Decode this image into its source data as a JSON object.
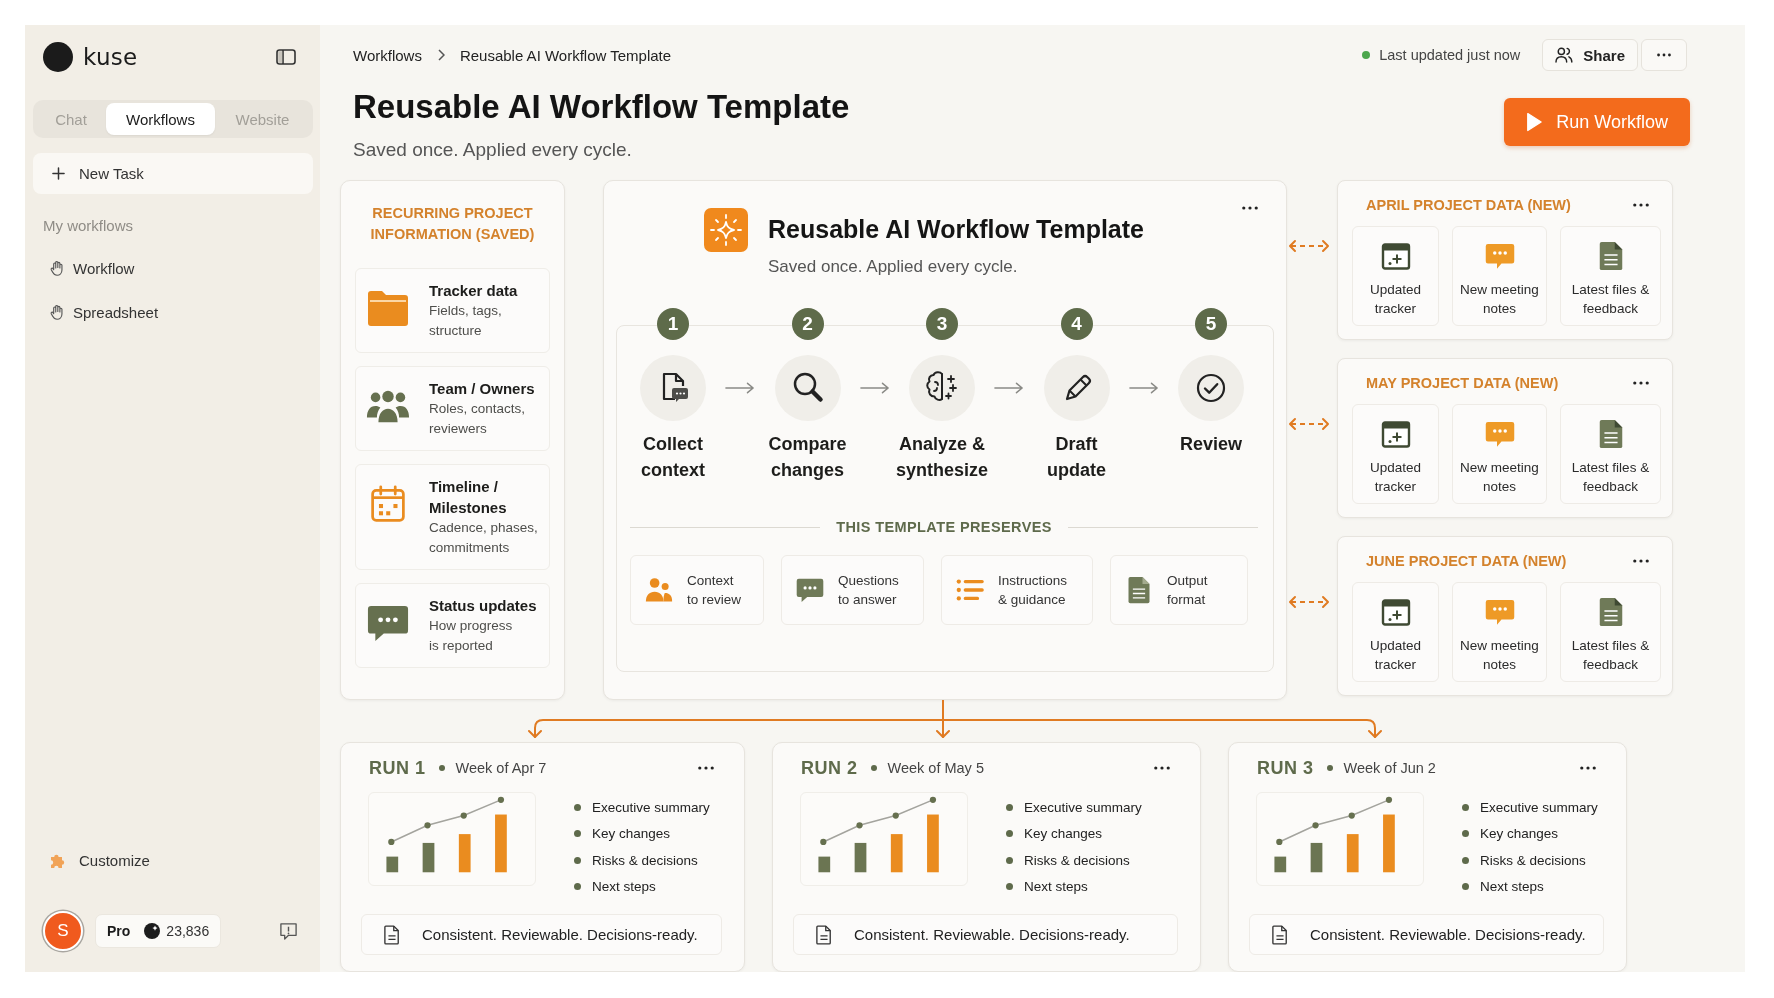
{
  "sidebar": {
    "brand": "kuse",
    "tabs": [
      {
        "label": "Chat",
        "selected": false
      },
      {
        "label": "Workflows",
        "selected": true
      },
      {
        "label": "Website",
        "selected": false
      }
    ],
    "new_task": "New Task",
    "section_label": "My workflows",
    "items": [
      {
        "label": "Workflow"
      },
      {
        "label": "Spreadsheet"
      }
    ],
    "customize": "Customize",
    "user": {
      "avatar_initial": "S",
      "plan": "Pro",
      "credits": "23,836"
    }
  },
  "header": {
    "breadcrumb": [
      "Workflows",
      "Reusable AI Workflow Template"
    ],
    "status": "Last updated just now",
    "share": "Share",
    "title": "Reusable AI Workflow Template",
    "subtitle": "Saved once. Applied every cycle.",
    "run_button": "Run Workflow"
  },
  "saved_info": {
    "heading": "RECURRING PROJECT INFORMATION (SAVED)",
    "items": [
      {
        "title": "Tracker data",
        "description": "Fields, tags,\nstructure"
      },
      {
        "title": "Team / Owners",
        "description": "Roles, contacts,\nreviewers"
      },
      {
        "title": "Timeline / Milestones",
        "description": "Cadence, phases,\ncommitments"
      },
      {
        "title": "Status updates",
        "description": "How progress\nis reported"
      }
    ]
  },
  "workflow_card": {
    "title": "Reusable AI Workflow Template",
    "subtitle": "Saved once. Applied every cycle.",
    "steps": [
      {
        "number": "1",
        "label": "Collect context"
      },
      {
        "number": "2",
        "label": "Compare changes"
      },
      {
        "number": "3",
        "label": "Analyze & synthesize"
      },
      {
        "number": "4",
        "label": "Draft update"
      },
      {
        "number": "5",
        "label": "Review"
      }
    ],
    "preserves_heading": "THIS TEMPLATE PRESERVES",
    "preserves": [
      "Context\nto review",
      "Questions\nto answer",
      "Instructions\n& guidance",
      "Output\nformat"
    ]
  },
  "project_data": [
    {
      "title": "APRIL PROJECT DATA (NEW)",
      "items": [
        "Updated tracker",
        "New meeting notes",
        "Latest files & feedback"
      ]
    },
    {
      "title": "MAY PROJECT DATA (NEW)",
      "items": [
        "Updated tracker",
        "New meeting notes",
        "Latest files & feedback"
      ]
    },
    {
      "title": "JUNE PROJECT DATA (NEW)",
      "items": [
        "Updated tracker",
        "New meeting notes",
        "Latest files & feedback"
      ]
    }
  ],
  "runs": [
    {
      "label": "RUN 1",
      "week": "Week of Apr 7",
      "outputs": [
        "Executive summary",
        "Key changes",
        "Risks & decisions",
        "Next steps"
      ],
      "footer": "Consistent. Reviewable. Decisions-ready."
    },
    {
      "label": "RUN 2",
      "week": "Week of May 5",
      "outputs": [
        "Executive summary",
        "Key changes",
        "Risks & decisions",
        "Next steps"
      ],
      "footer": "Consistent. Reviewable. Decisions-ready."
    },
    {
      "label": "RUN 3",
      "week": "Week of Jun 2",
      "outputs": [
        "Executive summary",
        "Key changes",
        "Risks & decisions",
        "Next steps"
      ],
      "footer": "Consistent. Reviewable. Decisions-ready."
    }
  ]
}
